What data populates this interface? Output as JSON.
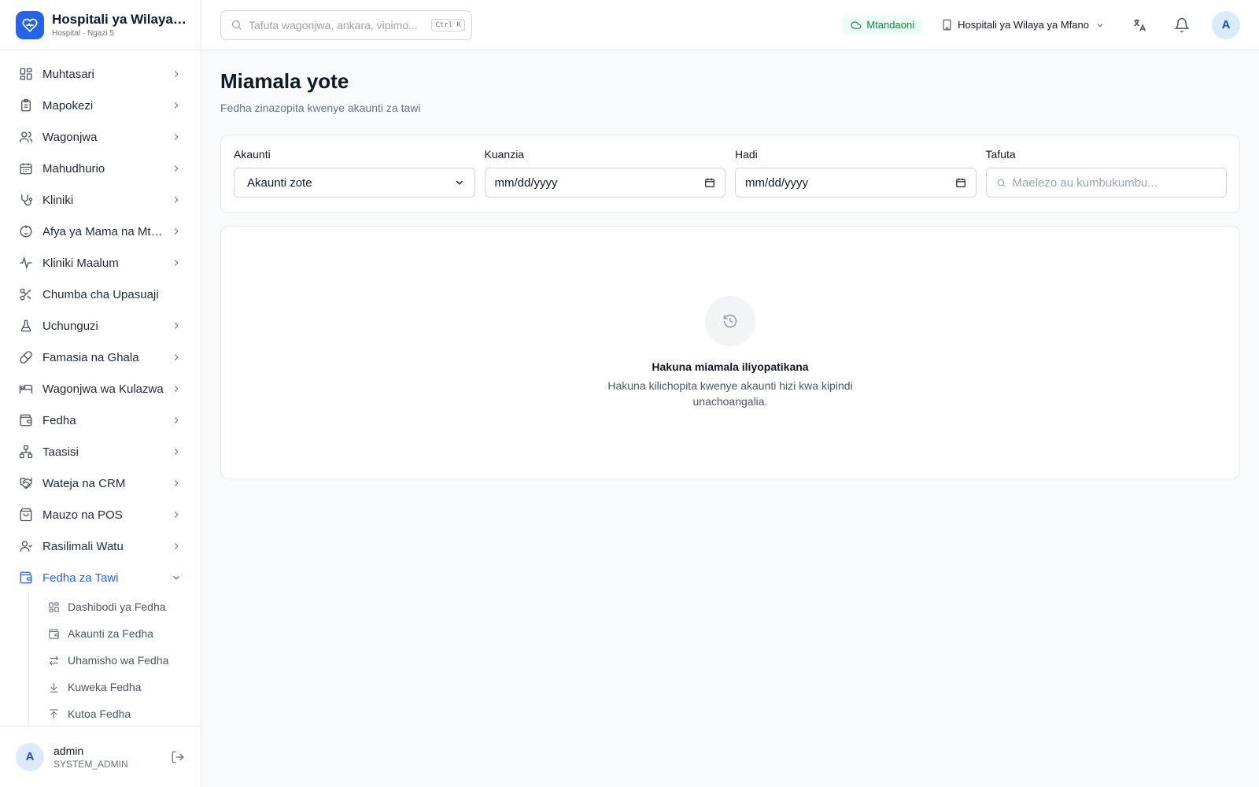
{
  "brand": {
    "name": "Hospitali ya Wilaya ya Mfano",
    "subtitle": "Hospital · Ngazi 5"
  },
  "header": {
    "search_placeholder": "Tafuta wagonjwa, ankara, vipimo...",
    "shortcut": "Ctrl K",
    "status": "Mtandaoni",
    "branch": "Hospitali ya Wilaya ya Mfano",
    "avatar_initial": "A"
  },
  "sidebar": {
    "items": [
      {
        "label": "Muhtasari",
        "icon": "grid-icon"
      },
      {
        "label": "Mapokezi",
        "icon": "clipboard-icon"
      },
      {
        "label": "Wagonjwa",
        "icon": "users-icon"
      },
      {
        "label": "Mahudhurio",
        "icon": "calendar-icon"
      },
      {
        "label": "Kliniki",
        "icon": "stethoscope-icon"
      },
      {
        "label": "Afya ya Mama na Mtoto",
        "icon": "baby-icon"
      },
      {
        "label": "Kliniki Maalum",
        "icon": "activity-icon"
      },
      {
        "label": "Chumba cha Upasuaji",
        "icon": "scissors-icon"
      },
      {
        "label": "Uchunguzi",
        "icon": "flask-icon"
      },
      {
        "label": "Famasia na Ghala",
        "icon": "pill-icon"
      },
      {
        "label": "Wagonjwa wa Kulazwa",
        "icon": "bed-icon"
      },
      {
        "label": "Fedha",
        "icon": "wallet-icon"
      },
      {
        "label": "Taasisi",
        "icon": "network-icon"
      },
      {
        "label": "Wateja na CRM",
        "icon": "handshake-icon"
      },
      {
        "label": "Mauzo na POS",
        "icon": "shopping-bag-icon"
      },
      {
        "label": "Rasilimali Watu",
        "icon": "user-group-icon"
      },
      {
        "label": "Fedha za Tawi",
        "icon": "wallet-icon"
      }
    ],
    "subitems": [
      {
        "label": "Dashibodi ya Fedha",
        "icon": "grid-icon"
      },
      {
        "label": "Akaunti za Fedha",
        "icon": "wallet-icon"
      },
      {
        "label": "Uhamisho wa Fedha",
        "icon": "transfer-icon"
      },
      {
        "label": "Kuweka Fedha",
        "icon": "download-icon"
      },
      {
        "label": "Kutoa Fedha",
        "icon": "upload-icon"
      }
    ]
  },
  "user": {
    "initial": "A",
    "name": "admin",
    "role": "SYSTEM_ADMIN"
  },
  "page": {
    "title": "Miamala yote",
    "subtitle": "Fedha zinazopita kwenye akaunti za tawi"
  },
  "filters": {
    "account_label": "Akaunti",
    "account_value": "Akaunti zote",
    "from_label": "Kuanzia",
    "from_value": "mm/dd/yyyy",
    "to_label": "Hadi",
    "to_value": "mm/dd/yyyy",
    "search_label": "Tafuta",
    "search_placeholder": "Maelezo au kumbukumbu..."
  },
  "empty": {
    "title": "Hakuna miamala iliyopatikana",
    "description": "Hakuna kilichopita kwenye akaunti hizi kwa kipindi unachoangalia."
  },
  "colors": {
    "accent": "#2563eb",
    "online_bg": "#ecfdf5",
    "online_text": "#15803d"
  }
}
